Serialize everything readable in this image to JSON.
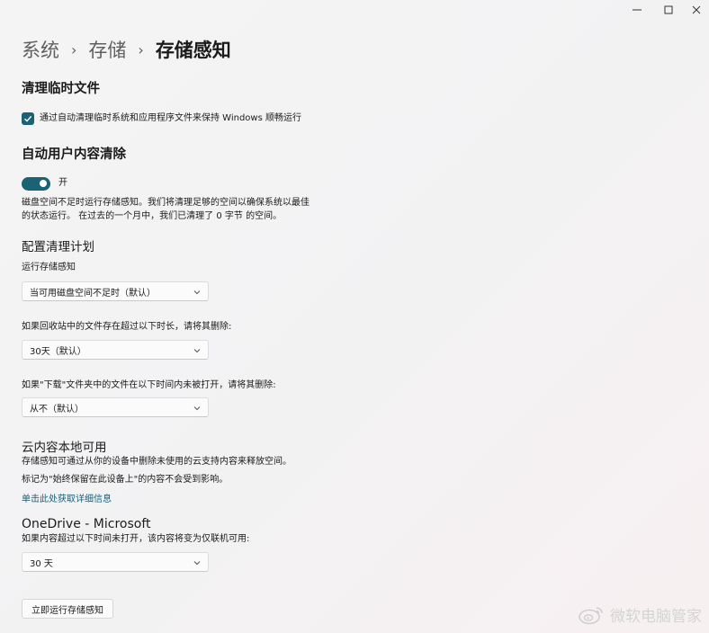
{
  "window": {
    "minimize_icon": "minimize-icon",
    "maximize_icon": "maximize-icon",
    "close_icon": "close-icon"
  },
  "breadcrumb": {
    "items": [
      "系统",
      "存储",
      "存储感知"
    ],
    "separator": "›"
  },
  "temp_files": {
    "title": "清理临时文件",
    "checkbox_label": "通过自动清理临时系统和应用程序文件来保持 Windows 顺畅运行",
    "checked": true
  },
  "auto_cleanup": {
    "title": "自动用户内容清除",
    "toggle_state": "开",
    "toggle_on": true,
    "description_line1": "磁盘空间不足时运行存储感知。我们将清理足够的空间以确保系统以最佳",
    "description_line2": "的状态运行。 在过去的一个月中，我们已清理了 0 字节 的空间。"
  },
  "schedule": {
    "title": "配置清理计划",
    "run_label": "运行存储感知",
    "run_value": "当可用磁盘空间不足时（默认）",
    "recycle_label": "如果回收站中的文件存在超过以下时长，请将其删除:",
    "recycle_value": "30天（默认）",
    "downloads_label": "如果\"下载\"文件夹中的文件在以下时间内未被打开，请将其删除:",
    "downloads_value": "从不（默认）"
  },
  "cloud": {
    "title": "云内容本地可用",
    "line1": "存储感知可通过从你的设备中删除未使用的云支持内容来释放空间。",
    "line2": "标记为\"始终保留在此设备上\"的内容不会受到影响。",
    "link": "单击此处获取详细信息"
  },
  "onedrive": {
    "title": "OneDrive - Microsoft",
    "label": "如果内容超过以下时间未打开，该内容将变为仅联机可用:",
    "value": "30 天"
  },
  "run_now_button": "立即运行存储感知",
  "watermark": {
    "text": "微软电脑管家",
    "icon": "weibo-icon"
  },
  "colors": {
    "accent": "#1a6274",
    "link": "#1a5e78",
    "background": "#f3f3f3"
  }
}
